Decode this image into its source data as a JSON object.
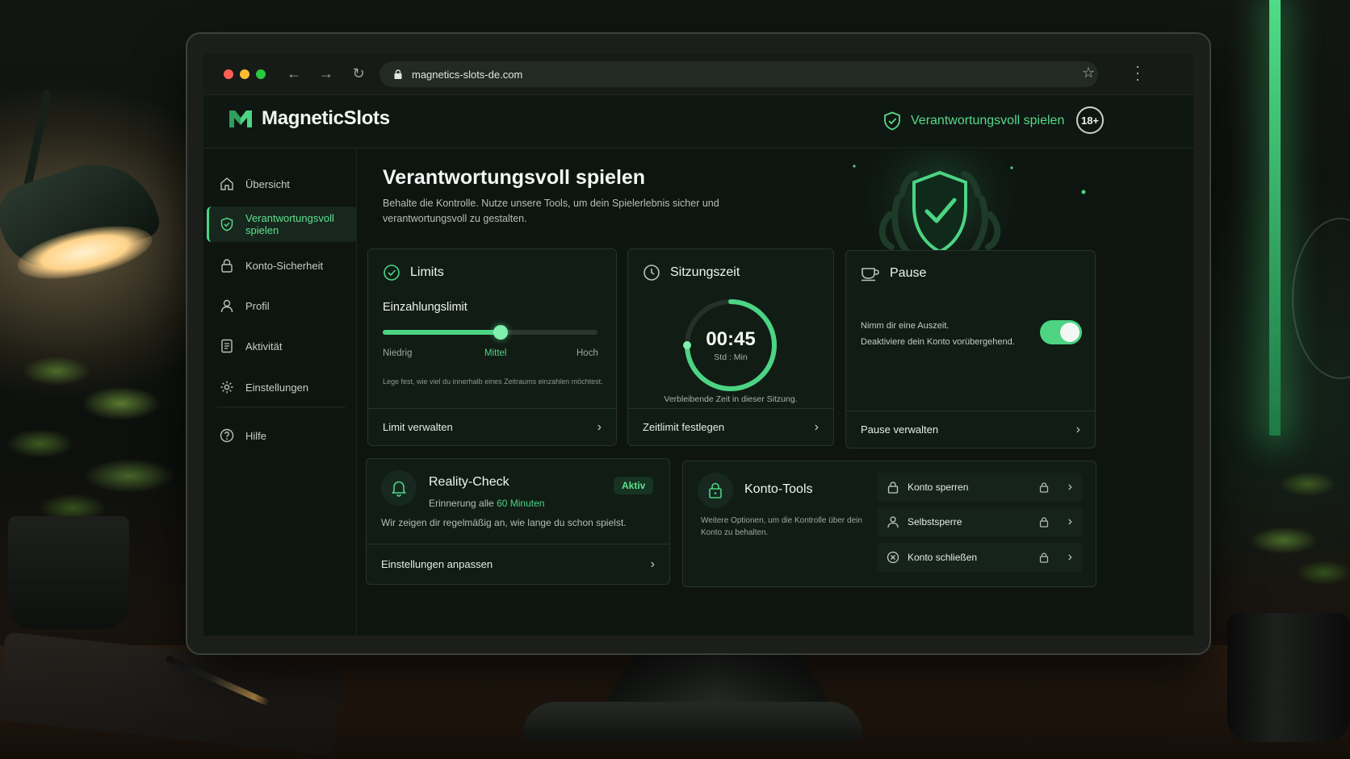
{
  "browser": {
    "url": "magnetics-slots-de.com"
  },
  "header": {
    "brand": "MagneticSlots",
    "badge_label": "Verantwortungsvoll spielen",
    "age_label": "18+"
  },
  "sidebar": {
    "items": [
      {
        "label": "Übersicht",
        "icon": "home-icon"
      },
      {
        "label": "Verantwortungsvoll spielen",
        "icon": "shield-icon",
        "active": true
      },
      {
        "label": "Konto-Sicherheit",
        "icon": "lock-icon"
      },
      {
        "label": "Profil",
        "icon": "user-icon"
      },
      {
        "label": "Aktivität",
        "icon": "document-icon"
      },
      {
        "label": "Einstellungen",
        "icon": "gear-icon"
      },
      {
        "label": "Hilfe",
        "icon": "help-icon"
      }
    ]
  },
  "page": {
    "title": "Verantwortungsvoll spielen",
    "subtitle": "Behalte die Kontrolle. Nutze unsere Tools, um dein Spielerlebnis sicher und verantwortungsvoll zu gestalten."
  },
  "limits": {
    "title": "Limits",
    "slider_label": "Einzahlungslimit",
    "slider_value": 0.55,
    "levels": [
      "Niedrig",
      "Mittel",
      "Hoch"
    ],
    "note": "Lege fest, wie viel du innerhalb eines Zeitraums einzahlen möchtest.",
    "action": "Limit verwalten"
  },
  "session": {
    "title": "Sitzungszeit",
    "time": "00:45",
    "unit": "Std : Min",
    "progress": 0.75,
    "note": "Verbleibende Zeit in dieser Sitzung.",
    "action": "Zeitlimit festlegen"
  },
  "pause": {
    "title": "Pause",
    "line1": "Nimm dir eine Auszeit.",
    "line2": "Deaktiviere dein Konto vorübergehend.",
    "toggle_on": true,
    "action": "Pause verwalten"
  },
  "reality": {
    "title": "Reality-Check",
    "status": "Aktiv",
    "reminder_prefix": "Erinnerung alle",
    "reminder_value": "60 Minuten",
    "text": "Wir zeigen dir regelmäßig an, wie lange du schon spielst.",
    "action": "Einstellungen anpassen"
  },
  "tools": {
    "title": "Konto-Tools",
    "text": "Weitere Optionen, um die Kontrolle über dein Konto zu behalten.",
    "rows": [
      {
        "label": "Konto sperren",
        "icon": "lock-icon"
      },
      {
        "label": "Selbstsperre",
        "icon": "user-icon"
      },
      {
        "label": "Konto schließen",
        "icon": "close-circle-icon"
      }
    ]
  },
  "colors": {
    "accent": "#4cd483",
    "background": "#0e1511",
    "card": "#111c15"
  }
}
